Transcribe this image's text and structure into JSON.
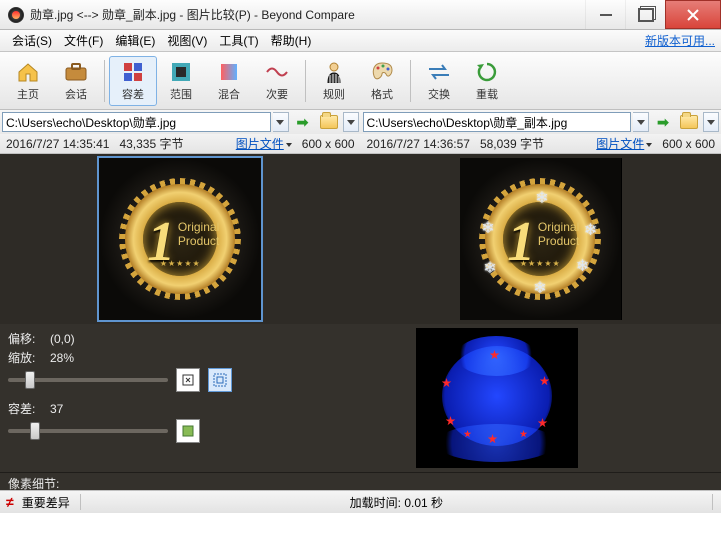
{
  "window": {
    "title": "勋章.jpg <--> 勋章_副本.jpg - 图片比较(P) - Beyond Compare",
    "new_version_hint": "新版本可用..."
  },
  "menu": {
    "session": "会话(S)",
    "file": "文件(F)",
    "edit": "编辑(E)",
    "view": "视图(V)",
    "tools": "工具(T)",
    "help": "帮助(H)"
  },
  "toolbar": {
    "home": "主页",
    "session": "会话",
    "diff": "容差",
    "range": "范围",
    "blend": "混合",
    "order": "次要",
    "rules": "规则",
    "format": "格式",
    "swap": "交换",
    "reload": "重载"
  },
  "paths": {
    "left": "C:\\Users\\echo\\Desktop\\勋章.jpg",
    "right": "C:\\Users\\echo\\Desktop\\勋章_副本.jpg"
  },
  "stats": {
    "left": {
      "date": "2016/7/27 14:35:41",
      "size": "43,335 字节",
      "filetype": "图片文件",
      "dims": "600 x 600"
    },
    "right": {
      "date": "2016/7/27 14:36:57",
      "size": "58,039 字节",
      "filetype": "图片文件",
      "dims": "600 x 600"
    }
  },
  "badge": {
    "script1": "Original",
    "script2": "Product"
  },
  "controls": {
    "offset_label": "偏移:",
    "offset_value": "(0,0)",
    "zoom_label": "缩放:",
    "zoom_value": "28%",
    "tolerance_label": "容差:",
    "tolerance_value": "37",
    "pixel_detail_label": "像素细节:"
  },
  "status": {
    "main": "重要差异",
    "load_time": "加载时间: 0.01 秒"
  }
}
